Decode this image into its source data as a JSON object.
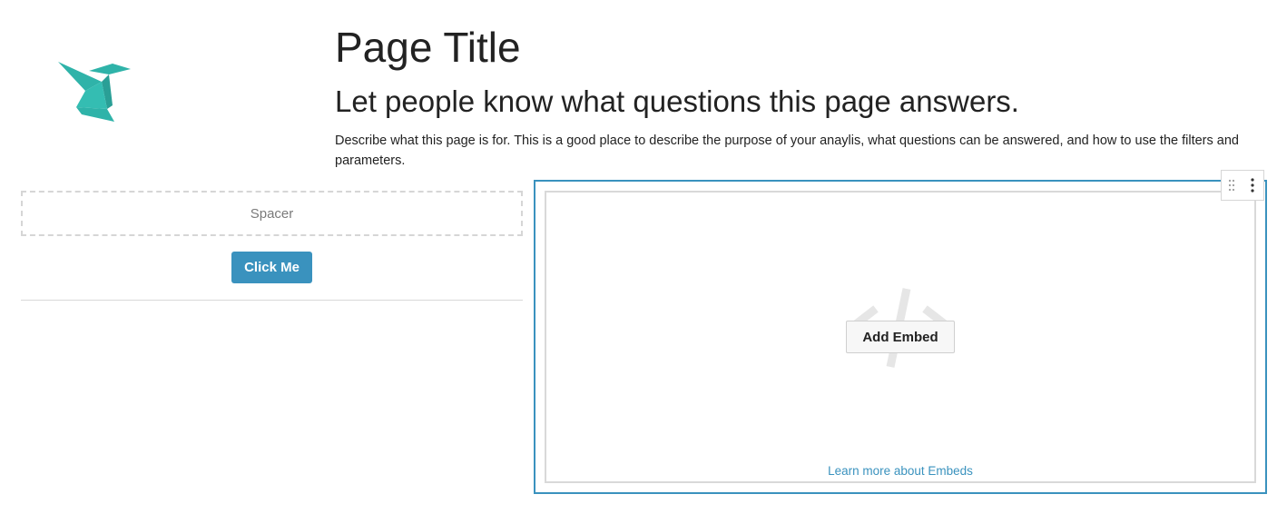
{
  "header": {
    "title": "Page Title",
    "subtitle": "Let people know what questions this page answers.",
    "description": "Describe what this page is for. This is a good place to describe the purpose of your anaylis, what questions can be answered, and how to use the filters and parameters."
  },
  "logo": {
    "icon": "origami-bird-logo",
    "color": "#2fb3a9"
  },
  "left_column": {
    "spacer_label": "Spacer",
    "button_label": "Click Me"
  },
  "embed": {
    "icon": "code-icon",
    "add_label": "Add Embed",
    "learn_more": "Learn more about Embeds"
  },
  "toolbar": {
    "drag_icon": "drag-handle-icon",
    "menu_icon": "more-vertical-icon"
  },
  "colors": {
    "accent": "#3a92be",
    "logo": "#2fb3a9",
    "border": "#d9d9d9",
    "text": "#222222"
  }
}
